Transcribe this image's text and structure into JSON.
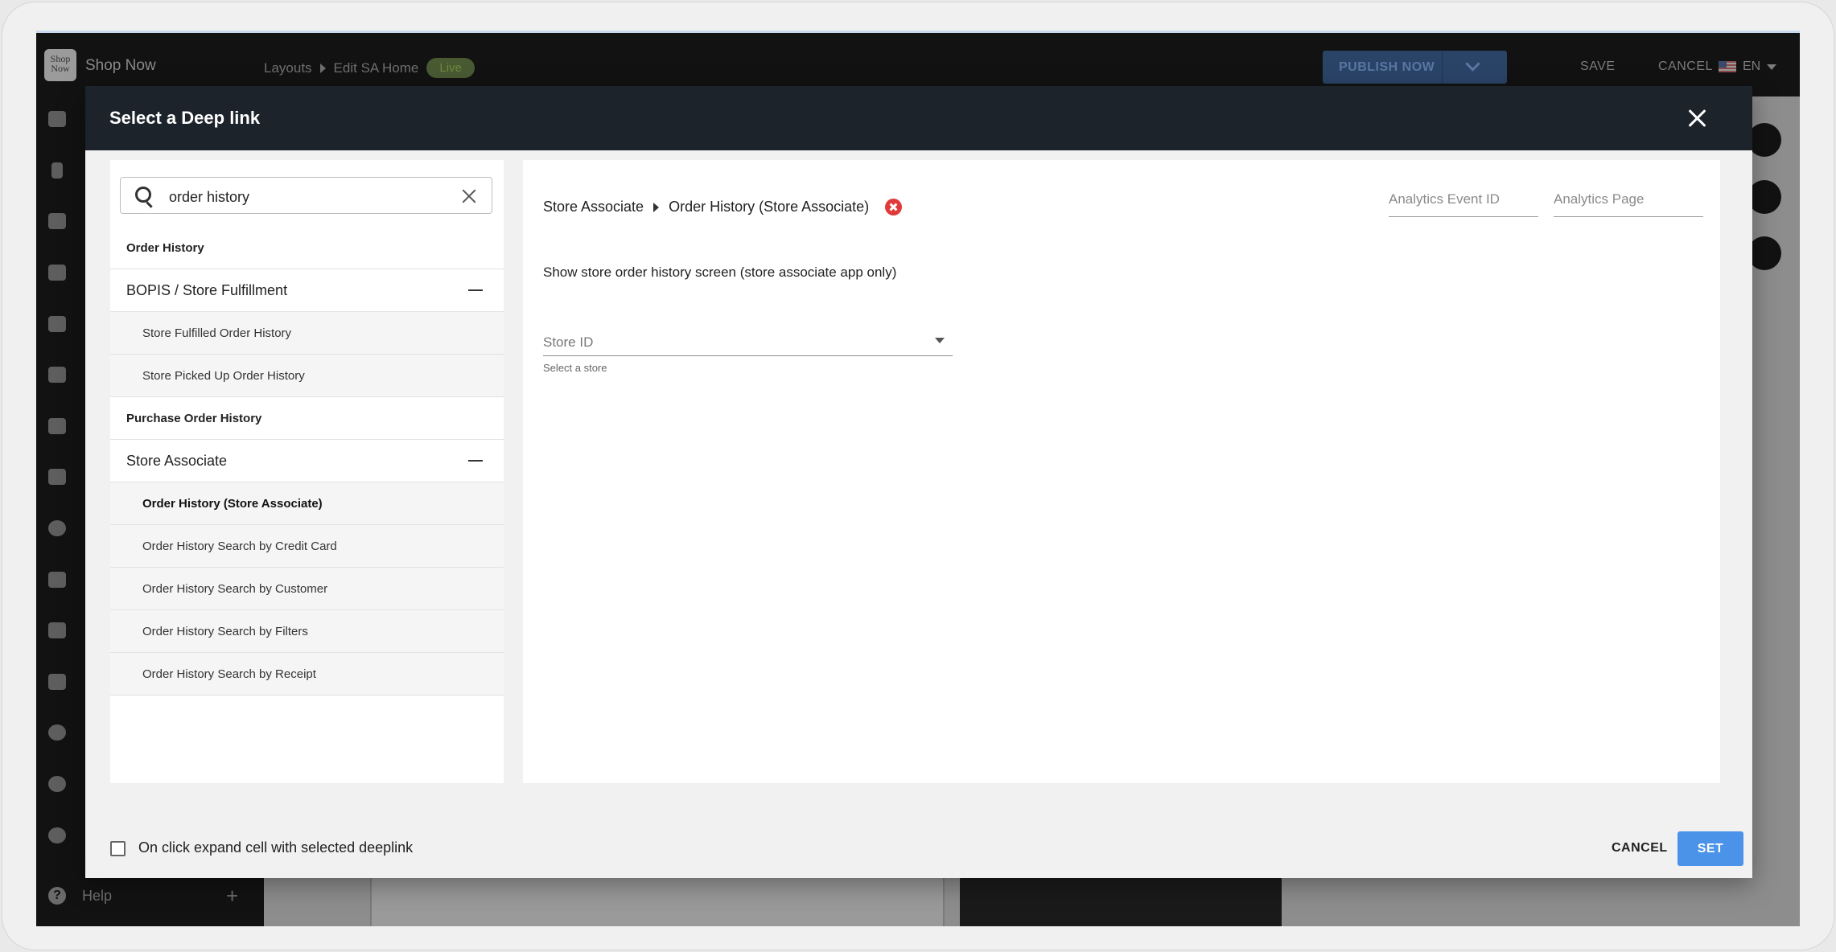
{
  "app": {
    "logo_text": "Shop Now",
    "name": "Shop Now",
    "breadcrumbs": [
      "Layouts",
      "Edit SA Home"
    ],
    "status_badge": "Live",
    "publish_label": "PUBLISH NOW",
    "save_label": "SAVE",
    "cancel_label": "CANCEL",
    "language": "EN",
    "help_label": "Help",
    "nav_icons": [
      "desktop-icon",
      "mobile-icon",
      "grid-icon",
      "store-icon",
      "truck-icon",
      "basket-icon",
      "feed-icon",
      "basket-alt-icon",
      "badge-icon",
      "chart-icon",
      "bell-icon",
      "check-icon",
      "history-icon",
      "compass-icon",
      "gear-icon"
    ]
  },
  "modal": {
    "title": "Select a Deep link",
    "search": {
      "value": "order history"
    },
    "list": [
      {
        "type": "top",
        "label": "Order History"
      },
      {
        "type": "group",
        "label": "BOPIS / Store Fulfillment",
        "expanded": true
      },
      {
        "type": "child",
        "label": "Store Fulfilled Order History"
      },
      {
        "type": "child",
        "label": "Store Picked Up Order History"
      },
      {
        "type": "top",
        "label": "Purchase Order History"
      },
      {
        "type": "group",
        "label": "Store Associate",
        "expanded": true
      },
      {
        "type": "child",
        "label": "Order History (Store Associate)",
        "selected": true
      },
      {
        "type": "child",
        "label": "Order History Search by Credit Card"
      },
      {
        "type": "child",
        "label": "Order History Search by Customer"
      },
      {
        "type": "child",
        "label": "Order History Search by Filters"
      },
      {
        "type": "child",
        "label": "Order History Search by Receipt"
      }
    ],
    "detail": {
      "breadcrumb_parent": "Store Associate",
      "breadcrumb_current": "Order History (Store Associate)",
      "analytics_event_placeholder": "Analytics Event ID",
      "analytics_page_placeholder": "Analytics Page",
      "description": "Show store order history screen (store associate app only)",
      "store_id_placeholder": "Store ID",
      "store_id_helper": "Select a store"
    },
    "footer": {
      "checkbox_label": "On click expand cell with selected deeplink",
      "checkbox_checked": false,
      "cancel_label": "CANCEL",
      "set_label": "SET"
    }
  },
  "colors": {
    "modal_header": "#1c232b",
    "primary_button": "#4a93e8",
    "remove_icon": "#e03a3a"
  }
}
